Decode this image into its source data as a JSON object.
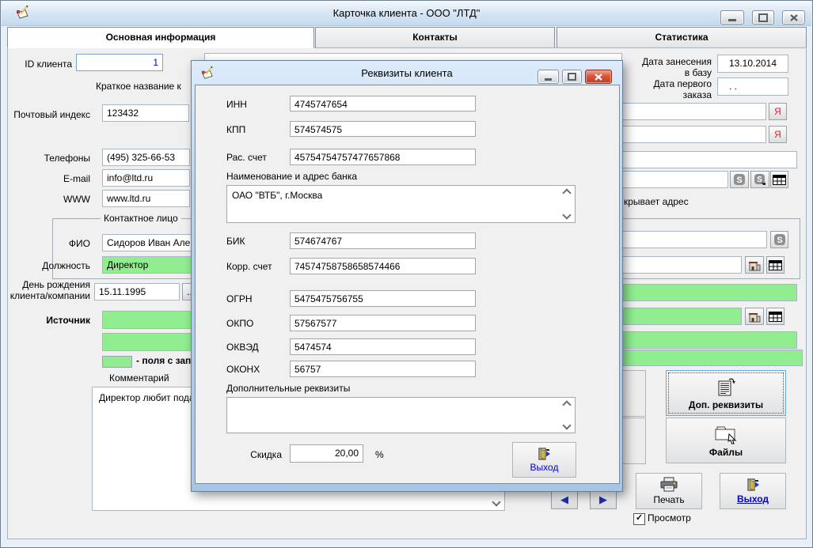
{
  "icons": {
    "nav_left": "◀",
    "nav_right": "▶",
    "check": "✓",
    "more": "...",
    "ya": "Я"
  },
  "colors": {
    "filled_field_green": "#90ee90",
    "ya_red": "#dd2222",
    "link_blue": "#0000cc",
    "focus_border": "#66a7e8"
  },
  "main": {
    "title": "Карточка клиента  -  ООО \"ЛТД\"",
    "tabs": [
      {
        "label": "Основная информация"
      },
      {
        "label": "Контакты"
      },
      {
        "label": "Статистика"
      }
    ],
    "left": {
      "id_label": "ID клиента",
      "id_value": "1",
      "hidden_label_fragment": "К",
      "short_name_label": "Краткое название к",
      "postal_label": "Почтовый индекс",
      "postal_value": "123432",
      "phones_label": "Телефоны",
      "phones_value": "(495) 325-66-53",
      "email_label": "E-mail",
      "email_value": "info@ltd.ru",
      "www_label": "WWW",
      "www_value": "www.ltd.ru",
      "contact_group_label": "Контактное лицо",
      "fio_label": "ФИО",
      "fio_value": "Сидоров Иван Але",
      "position_label": "Должность",
      "position_value": "Директор",
      "birthday_label_1": "День рождения",
      "birthday_label_2": "клиента/компании",
      "birthday_value": "15.11.1995",
      "source_label": "Источник",
      "legend_text": "- поля с зап",
      "comment_label": "Комментарий",
      "comment_value": "Директор любит подарки"
    },
    "right": {
      "date_added_label_1": "Дата занесения",
      "date_added_label_2": "в базу",
      "date_added_value": "13.10.2014",
      "first_order_label_1": "Дата первого",
      "first_order_label_2": "заказа",
      "first_order_value": ". .",
      "address_fragment": "крывает адрес"
    },
    "buttons": {
      "extra_requisites": "Доп. реквизиты",
      "files": "Файлы",
      "print": "Печать",
      "exit": "Выход",
      "preview_checkbox": "Просмотр"
    }
  },
  "dialog": {
    "title": "Реквизиты клиента",
    "fields": {
      "inn_label": "ИНН",
      "inn_value": "4745747654",
      "kpp_label": "КПП",
      "kpp_value": "574574575",
      "account_label": "Рас. счет",
      "account_value": "45754754757477657868",
      "bank_label": "Наименование и адрес банка",
      "bank_value": "ОАО \"ВТБ\", г.Москва",
      "bik_label": "БИК",
      "bik_value": "574674767",
      "corr_label": "Корр. счет",
      "corr_value": "74574758758658574466",
      "ogrn_label": "ОГРН",
      "ogrn_value": "5475475756755",
      "okpo_label": "ОКПО",
      "okpo_value": "57567577",
      "okved_label": "ОКВЭД",
      "okved_value": "5474574",
      "okonh_label": "ОКОНХ",
      "okonh_value": "56757",
      "extra_label": "Дополнительные реквизиты",
      "extra_value": "",
      "discount_label": "Скидка",
      "discount_value": "20,00",
      "discount_unit": "%"
    },
    "exit_button": "Выход"
  }
}
